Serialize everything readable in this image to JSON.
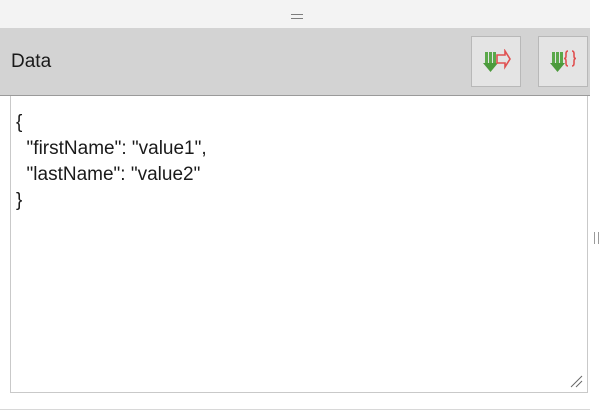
{
  "panel": {
    "title": "Data",
    "buttons": [
      {
        "icon": "export-arrow-icon",
        "color_primary": "#4caf50",
        "color_secondary": "#e05050"
      },
      {
        "icon": "import-braces-icon",
        "color_primary": "#4caf50",
        "color_secondary": "#e05050"
      }
    ]
  },
  "editor": {
    "content": "{\n  \"firstName\": \"value1\",\n  \"lastName\": \"value2\"\n}"
  },
  "colors": {
    "header_bg": "#d3d3d3",
    "splitter_bg": "#f3f3f3",
    "text": "#1a1a1a"
  }
}
